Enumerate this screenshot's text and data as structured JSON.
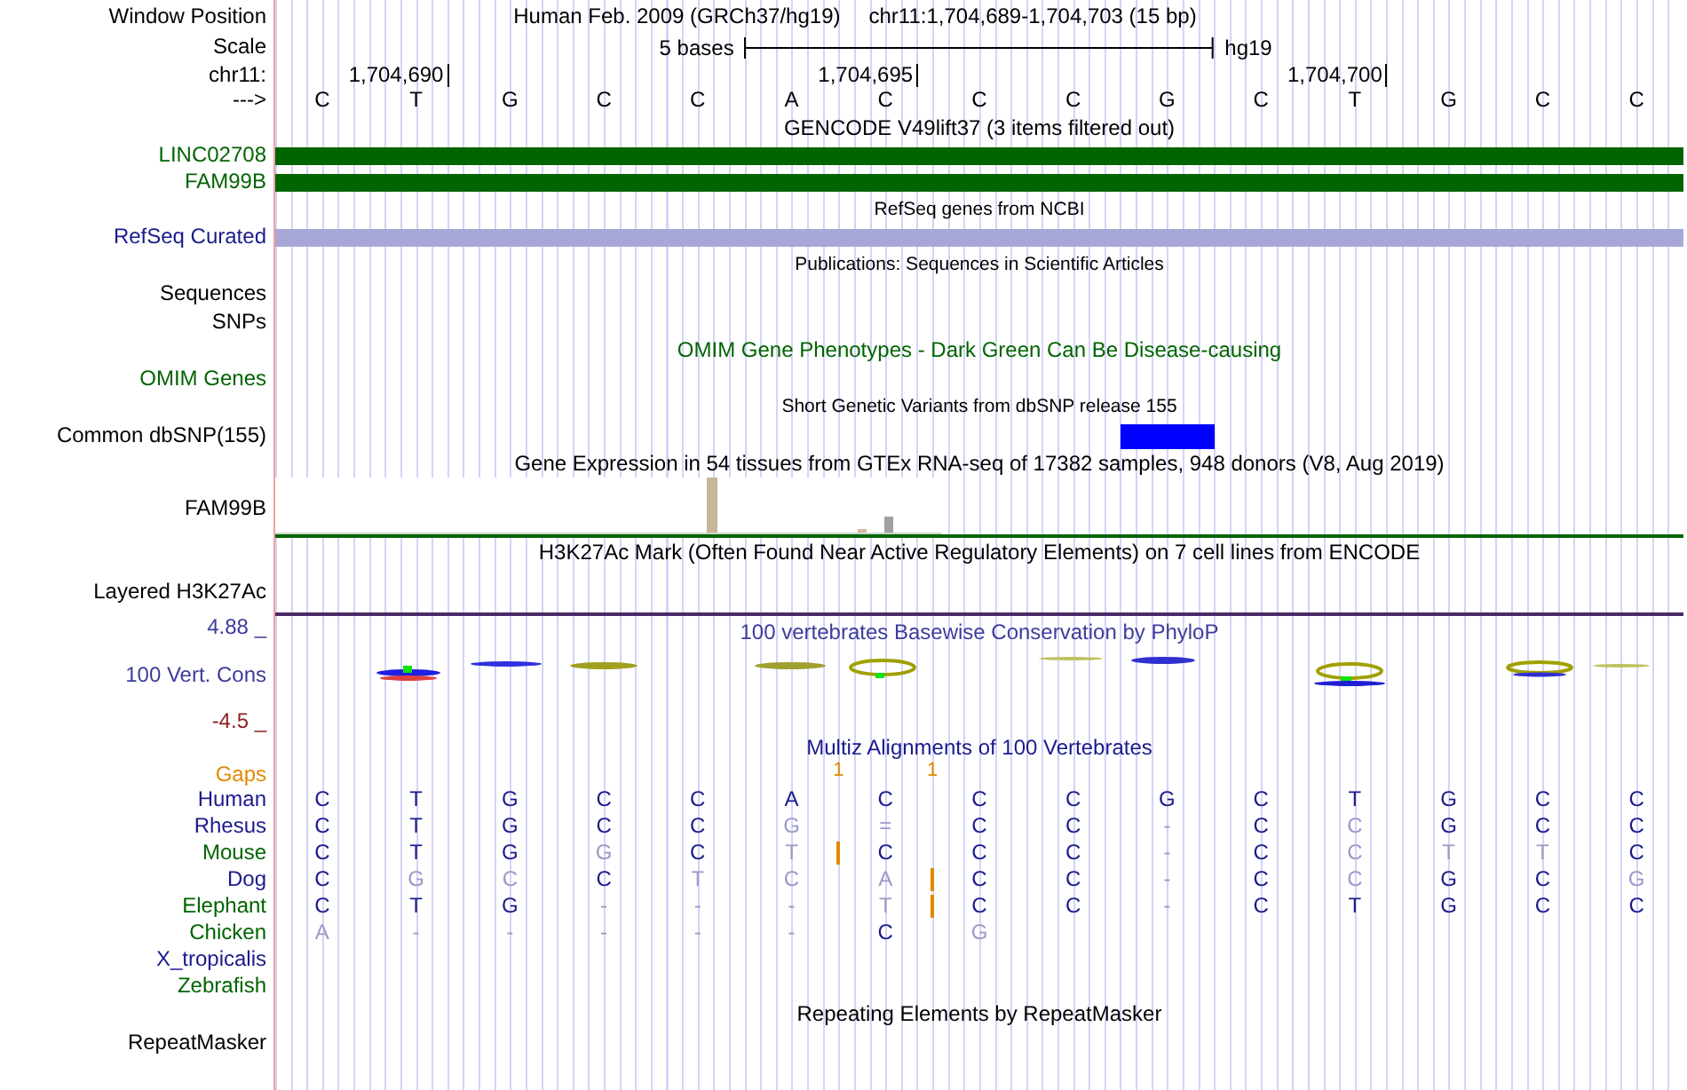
{
  "header": {
    "position_label": "Window Position",
    "assembly_title": "Human Feb. 2009 (GRCh37/hg19)",
    "range": "chr11:1,704,689-1,704,703 (15 bp)",
    "scale_label": "Scale",
    "scale_text": "5 bases",
    "scale_assembly": "hg19",
    "chrom_label": "chr11:",
    "strand_label": "--->",
    "positions": [
      "1,704,690",
      "1,704,695",
      "1,704,700"
    ],
    "bases": [
      "C",
      "T",
      "G",
      "C",
      "C",
      "A",
      "C",
      "C",
      "C",
      "G",
      "C",
      "T",
      "G",
      "C",
      "C"
    ]
  },
  "tracks": [
    {
      "kind": "title",
      "text": "GENCODE V49lift37 (3 items filtered out)",
      "small": false,
      "color": "#000000"
    },
    {
      "kind": "gene",
      "label": {
        "text": "LINC02708",
        "color": "#006400"
      },
      "color": "#006400"
    },
    {
      "kind": "gene",
      "label": {
        "text": "FAM99B",
        "color": "#006400"
      },
      "color": "#006400"
    },
    {
      "kind": "title",
      "text": "RefSeq genes from NCBI",
      "small": true,
      "color": "#000000"
    },
    {
      "kind": "gene",
      "label": {
        "text": "RefSeq Curated",
        "color": "#1a1a8c"
      },
      "color": "#a8a8d8"
    },
    {
      "kind": "title",
      "text": "Publications: Sequences in Scientific Articles",
      "small": true,
      "color": "#000000"
    },
    {
      "kind": "label",
      "label": {
        "text": "Sequences",
        "color": "#000000"
      }
    },
    {
      "kind": "label",
      "label": {
        "text": "SNPs",
        "color": "#000000"
      }
    },
    {
      "kind": "title",
      "text": "OMIM Gene Phenotypes - Dark Green Can Be Disease-causing",
      "small": false,
      "color": "#006400"
    },
    {
      "kind": "label",
      "label": {
        "text": "OMIM Genes",
        "color": "#006400"
      }
    },
    {
      "kind": "title",
      "text": "Short Genetic Variants from dbSNP release 155",
      "small": true,
      "color": "#000000"
    },
    {
      "kind": "snp",
      "label": {
        "text": "Common dbSNP(155)",
        "color": "#000000"
      },
      "color": "#0000ff",
      "covered": [
        false,
        false,
        false,
        false,
        false,
        false,
        false,
        false,
        false,
        true,
        false,
        false,
        false,
        false,
        false
      ]
    },
    {
      "kind": "title",
      "text": "Gene Expression in 54 tissues from GTEx RNA-seq of 17382 samples, 948 donors (V8, Aug 2019)",
      "small": false,
      "color": "#000000"
    },
    {
      "kind": "expression",
      "label": {
        "text": "FAM99B",
        "color": "#000000"
      }
    },
    {
      "kind": "title",
      "text": "H3K27Ac Mark (Often Found Near Active Regulatory Elements) on 7 cell lines from ENCODE",
      "small": false,
      "color": "#000000"
    },
    {
      "kind": "signal",
      "label": {
        "text": "Layered H3K27Ac",
        "color": "#000000"
      }
    },
    {
      "kind": "conservation",
      "title": "100 vertebrates Basewise Conservation by PhyloP",
      "label": {
        "text": "100 Vert. Cons",
        "color": "#3c3c9c"
      },
      "axis_max": {
        "text": "4.88 _",
        "color": "#3c3c9c"
      },
      "axis_min": {
        "text": "-4.5 _",
        "color": "#8b2020"
      }
    },
    {
      "kind": "title",
      "text": "Multiz Alignments of 100 Vertebrates",
      "small": false,
      "color": "#1a1a8c"
    },
    {
      "kind": "gaps",
      "label": {
        "text": "Gaps",
        "color": "#e08a00"
      },
      "marks": [
        "1",
        "1"
      ]
    },
    {
      "kind": "species",
      "label": {
        "text": "Human",
        "color": "#1a1a8c"
      },
      "bases": [
        {
          "text": "C",
          "faded": false,
          "insert_after": false
        },
        {
          "text": "T",
          "faded": false,
          "insert_after": false
        },
        {
          "text": "G",
          "faded": false,
          "insert_after": false
        },
        {
          "text": "C",
          "faded": false,
          "insert_after": false
        },
        {
          "text": "C",
          "faded": false,
          "insert_after": false
        },
        {
          "text": "A",
          "faded": false,
          "insert_after": false
        },
        {
          "text": "C",
          "faded": false,
          "insert_after": false
        },
        {
          "text": "C",
          "faded": false,
          "insert_after": false
        },
        {
          "text": "C",
          "faded": false,
          "insert_after": false
        },
        {
          "text": "G",
          "faded": false,
          "insert_after": false
        },
        {
          "text": "C",
          "faded": false,
          "insert_after": false
        },
        {
          "text": "T",
          "faded": false,
          "insert_after": false
        },
        {
          "text": "G",
          "faded": false,
          "insert_after": false
        },
        {
          "text": "C",
          "faded": false,
          "insert_after": false
        },
        {
          "text": "C",
          "faded": false,
          "insert_after": false
        }
      ]
    },
    {
      "kind": "species",
      "label": {
        "text": "Rhesus",
        "color": "#1a1a8c"
      },
      "bases": [
        {
          "text": "C",
          "faded": false,
          "insert_after": false
        },
        {
          "text": "T",
          "faded": false,
          "insert_after": false
        },
        {
          "text": "G",
          "faded": false,
          "insert_after": false
        },
        {
          "text": "C",
          "faded": false,
          "insert_after": false
        },
        {
          "text": "C",
          "faded": false,
          "insert_after": false
        },
        {
          "text": "G",
          "faded": true,
          "insert_after": false
        },
        {
          "text": "=",
          "faded": true,
          "insert_after": false
        },
        {
          "text": "C",
          "faded": false,
          "insert_after": false
        },
        {
          "text": "C",
          "faded": false,
          "insert_after": false
        },
        {
          "text": "-",
          "faded": true,
          "insert_after": false
        },
        {
          "text": "C",
          "faded": false,
          "insert_after": false
        },
        {
          "text": "C",
          "faded": true,
          "insert_after": false
        },
        {
          "text": "G",
          "faded": false,
          "insert_after": false
        },
        {
          "text": "C",
          "faded": false,
          "insert_after": false
        },
        {
          "text": "C",
          "faded": false,
          "insert_after": false
        }
      ]
    },
    {
      "kind": "species",
      "label": {
        "text": "Mouse",
        "color": "#006400"
      },
      "bases": [
        {
          "text": "C",
          "faded": false,
          "insert_after": false
        },
        {
          "text": "T",
          "faded": false,
          "insert_after": false
        },
        {
          "text": "G",
          "faded": false,
          "insert_after": false
        },
        {
          "text": "G",
          "faded": true,
          "insert_after": false
        },
        {
          "text": "C",
          "faded": false,
          "insert_after": false
        },
        {
          "text": "T",
          "faded": true,
          "insert_after": true
        },
        {
          "text": "C",
          "faded": false,
          "insert_after": false
        },
        {
          "text": "C",
          "faded": false,
          "insert_after": false
        },
        {
          "text": "C",
          "faded": false,
          "insert_after": false
        },
        {
          "text": "-",
          "faded": true,
          "insert_after": false
        },
        {
          "text": "C",
          "faded": false,
          "insert_after": false
        },
        {
          "text": "C",
          "faded": true,
          "insert_after": false
        },
        {
          "text": "T",
          "faded": true,
          "insert_after": false
        },
        {
          "text": "T",
          "faded": true,
          "insert_after": false
        },
        {
          "text": "C",
          "faded": false,
          "insert_after": false
        }
      ]
    },
    {
      "kind": "species",
      "label": {
        "text": "Dog",
        "color": "#1a1a8c"
      },
      "bases": [
        {
          "text": "C",
          "faded": false,
          "insert_after": false
        },
        {
          "text": "G",
          "faded": true,
          "insert_after": false
        },
        {
          "text": "C",
          "faded": true,
          "insert_after": false
        },
        {
          "text": "C",
          "faded": false,
          "insert_after": false
        },
        {
          "text": "T",
          "faded": true,
          "insert_after": false
        },
        {
          "text": "C",
          "faded": true,
          "insert_after": false
        },
        {
          "text": "A",
          "faded": true,
          "insert_after": true
        },
        {
          "text": "C",
          "faded": false,
          "insert_after": false
        },
        {
          "text": "C",
          "faded": false,
          "insert_after": false
        },
        {
          "text": "-",
          "faded": true,
          "insert_after": false
        },
        {
          "text": "C",
          "faded": false,
          "insert_after": false
        },
        {
          "text": "C",
          "faded": true,
          "insert_after": false
        },
        {
          "text": "G",
          "faded": false,
          "insert_after": false
        },
        {
          "text": "C",
          "faded": false,
          "insert_after": false
        },
        {
          "text": "G",
          "faded": true,
          "insert_after": false
        }
      ]
    },
    {
      "kind": "species",
      "label": {
        "text": "Elephant",
        "color": "#006400"
      },
      "bases": [
        {
          "text": "C",
          "faded": false,
          "insert_after": false
        },
        {
          "text": "T",
          "faded": false,
          "insert_after": false
        },
        {
          "text": "G",
          "faded": false,
          "insert_after": false
        },
        {
          "text": "-",
          "faded": true,
          "insert_after": false
        },
        {
          "text": "-",
          "faded": true,
          "insert_after": false
        },
        {
          "text": "-",
          "faded": true,
          "insert_after": false
        },
        {
          "text": "T",
          "faded": true,
          "insert_after": true
        },
        {
          "text": "C",
          "faded": false,
          "insert_after": false
        },
        {
          "text": "C",
          "faded": false,
          "insert_after": false
        },
        {
          "text": "-",
          "faded": true,
          "insert_after": false
        },
        {
          "text": "C",
          "faded": false,
          "insert_after": false
        },
        {
          "text": "T",
          "faded": false,
          "insert_after": false
        },
        {
          "text": "G",
          "faded": false,
          "insert_after": false
        },
        {
          "text": "C",
          "faded": false,
          "insert_after": false
        },
        {
          "text": "C",
          "faded": false,
          "insert_after": false
        }
      ]
    },
    {
      "kind": "species",
      "label": {
        "text": "Chicken",
        "color": "#006400"
      },
      "bases": [
        {
          "text": "A",
          "faded": true,
          "insert_after": false
        },
        {
          "text": "-",
          "faded": true,
          "insert_after": false
        },
        {
          "text": "-",
          "faded": true,
          "insert_after": false
        },
        {
          "text": "-",
          "faded": true,
          "insert_after": false
        },
        {
          "text": "-",
          "faded": true,
          "insert_after": false
        },
        {
          "text": "-",
          "faded": true,
          "insert_after": false
        },
        {
          "text": "C",
          "faded": false,
          "insert_after": false
        },
        {
          "text": "G",
          "faded": true,
          "insert_after": false
        }
      ]
    },
    {
      "kind": "species",
      "label": {
        "text": "X_tropicalis",
        "color": "#1a1a8c"
      }
    },
    {
      "kind": "species",
      "label": {
        "text": "Zebrafish",
        "color": "#006400"
      }
    },
    {
      "kind": "title",
      "text": "Repeating Elements by RepeatMasker",
      "small": false,
      "color": "#000000"
    },
    {
      "kind": "label",
      "label": {
        "text": "RepeatMasker",
        "color": "#000000"
      }
    }
  ]
}
